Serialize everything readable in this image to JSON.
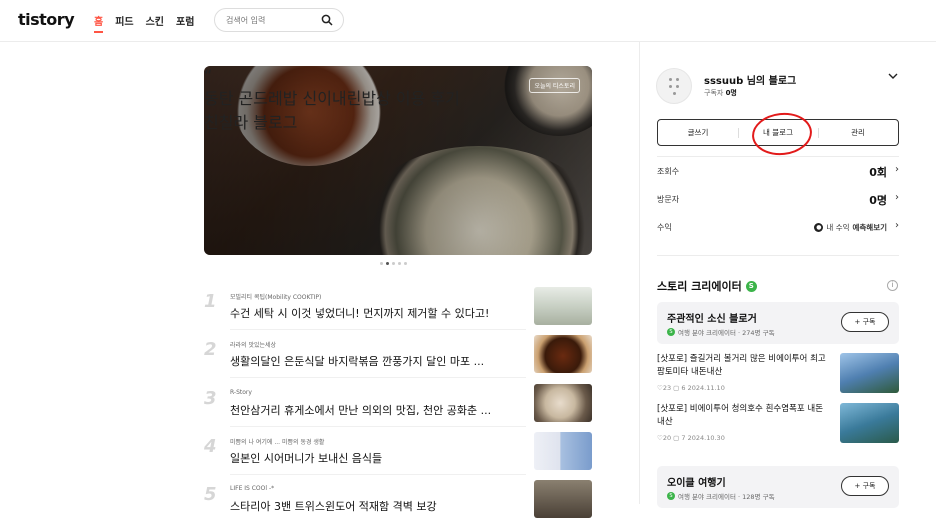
{
  "header": {
    "logo": "tistory",
    "nav": [
      "홈",
      "피드",
      "스킨",
      "포럼"
    ],
    "search_placeholder": "검색어 입력"
  },
  "hero": {
    "badge": "오늘의 티스토리",
    "quote_mark": "“",
    "title": "동탄 곤드레밥 신이내린밥상 이용 후기",
    "author": "친칠라 블로그"
  },
  "list": [
    {
      "num": "1",
      "category": "모빌리티 콕팁(Mobility COOKTIP)",
      "title": "수건 세탁 시 이것 넣었더니! 먼지까지 제거할 수 있다고!"
    },
    {
      "num": "2",
      "category": "라라의 맛있는세상",
      "title": "생활의달인 은둔식달 바지락볶음 깐풍가지 달인 마포 ..."
    },
    {
      "num": "3",
      "category": "R-Story",
      "title": "천안삼거리 휴게소에서 만난 의외의 맛집, 천안 공화춘 ..."
    },
    {
      "num": "4",
      "category": "미쁨의 나 여기에 ... 미쁨의 동경 생활",
      "title": "일본인 시어머니가 보내신 음식들"
    },
    {
      "num": "5",
      "category": "LIFE IS COOl -*",
      "title": "스타리아 3밴 트위스윈도어 적재함 격벽 보강"
    }
  ],
  "profile": {
    "name": "sssuub 님의 블로그",
    "subscribers_label": "구독자",
    "subscribers_value": "0명",
    "buttons": [
      "글쓰기",
      "내 블로그",
      "관리"
    ]
  },
  "stats": {
    "views_label": "조회수",
    "views_value": "0회",
    "visitors_label": "방문자",
    "visitors_value": "0명",
    "revenue_label": "수익",
    "revenue_prefix": "내 수익",
    "revenue_link": "예측해보기"
  },
  "creator": {
    "title": "스토리 크리에이터",
    "s_badge": "S",
    "cards": [
      {
        "name": "주관적인 소신 블로거",
        "sub": "여행 분야 크리에이터 · 274명 구독",
        "subscribe": "+ 구독"
      },
      {
        "name": "오이클 여행기",
        "sub": "여행 분야 크리에이터 · 128명 구독",
        "subscribe": "+ 구독"
      }
    ],
    "posts": [
      {
        "title": "[삿포로] 즐길거리 볼거리 많은 비에이투어 최고 팜토미타 내돈내산",
        "likes": "♡23",
        "comments": "6",
        "date": "2024.11.10"
      },
      {
        "title": "[삿포로] 비에이투어 청의호수 흰수염폭포 내돈내산",
        "likes": "♡20",
        "comments": "7",
        "date": "2024.10.30"
      }
    ]
  },
  "colors": {
    "accent": "#ff5544",
    "creator_green": "#3cb44a",
    "annotation_red": "#e21a1a"
  }
}
